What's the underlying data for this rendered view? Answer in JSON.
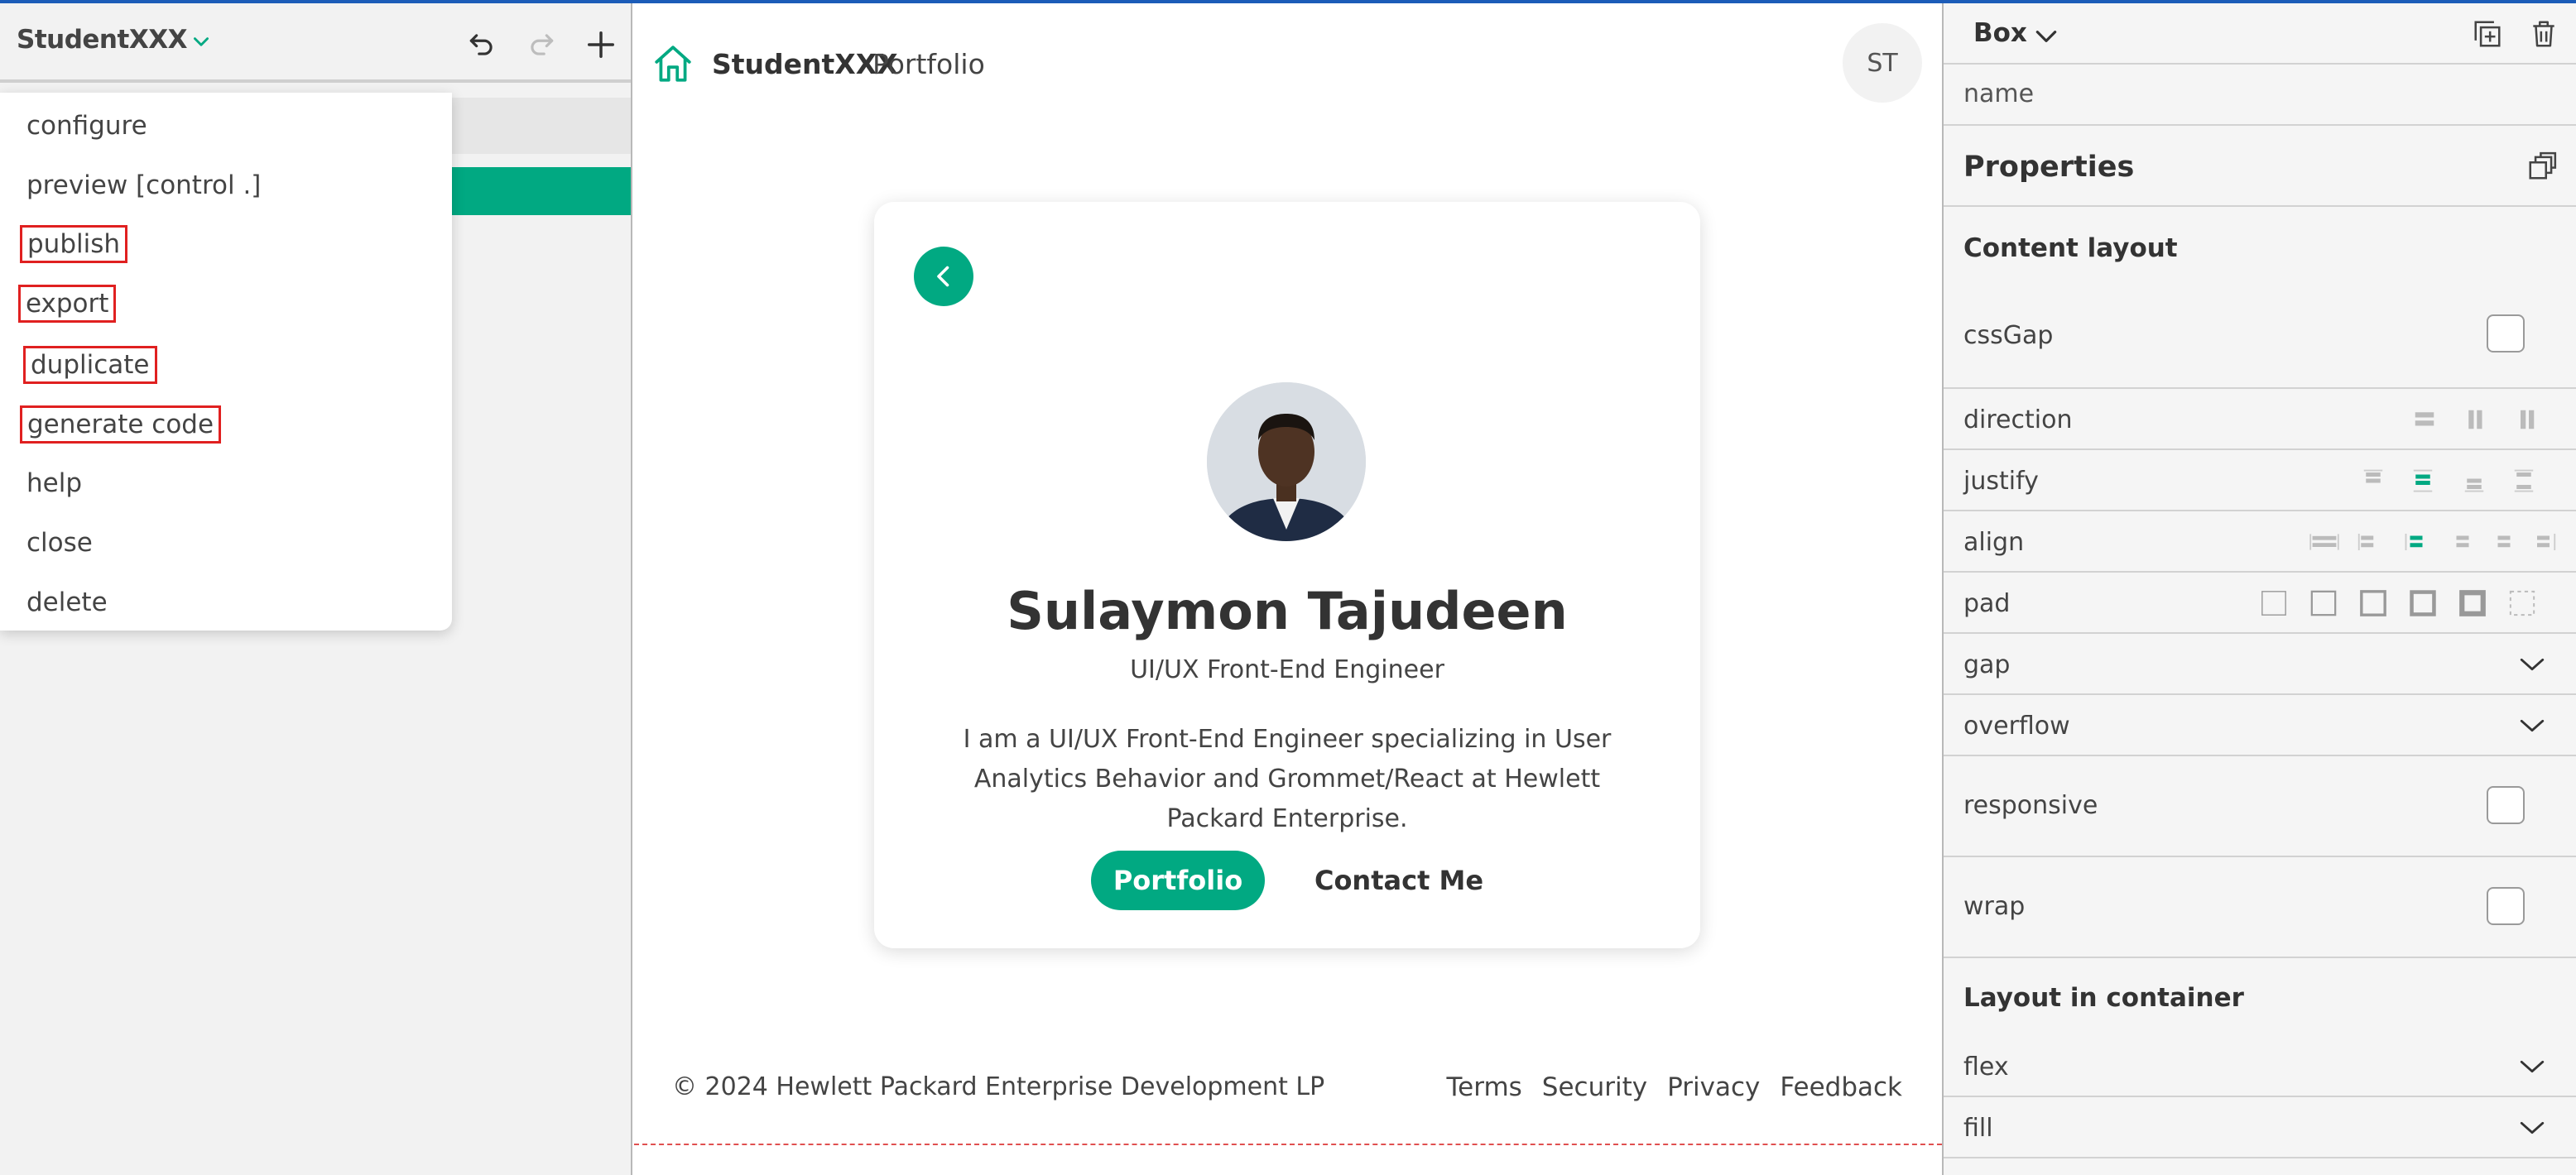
{
  "app": {
    "name": "StudentXXX",
    "icons": {
      "dropdown": "chevron-down-icon",
      "undo": "undo-icon",
      "redo": "redo-icon",
      "add": "plus-icon"
    }
  },
  "menu": {
    "items": [
      {
        "label": "configure",
        "highlighted": false
      },
      {
        "label": "preview [control .]",
        "highlighted": false
      },
      {
        "label": "publish",
        "highlighted": true
      },
      {
        "label": "export",
        "highlighted": true
      },
      {
        "label": "duplicate",
        "highlighted": true
      },
      {
        "label": "generate code",
        "highlighted": true
      },
      {
        "label": "help",
        "highlighted": false
      },
      {
        "label": "close",
        "highlighted": false
      },
      {
        "label": "delete",
        "highlighted": false
      }
    ]
  },
  "canvas": {
    "header": {
      "brand": "StudentXXX",
      "section": "Portfolio",
      "avatar_initials": "ST"
    },
    "card": {
      "name": "Sulaymon Tajudeen",
      "role": "UI/UX Front-End Engineer",
      "bio": "I am a UI/UX Front-End Engineer specializing in User Analytics Behavior and Grommet/React at Hewlett Packard Enterprise.",
      "primary_button": "Portfolio",
      "secondary_button": "Contact Me"
    },
    "footer": {
      "copyright": "© 2024 Hewlett Packard Enterprise Development LP",
      "links": [
        "Terms",
        "Security",
        "Privacy",
        "Feedback"
      ]
    }
  },
  "inspector": {
    "component": "Box",
    "name_placeholder": "name",
    "properties_title": "Properties",
    "content_layout_title": "Content layout",
    "rows": {
      "cssGap": "cssGap",
      "direction": "direction",
      "justify": "justify",
      "align": "align",
      "pad": "pad",
      "gap": "gap",
      "overflow": "overflow",
      "responsive": "responsive",
      "wrap": "wrap"
    },
    "layout_in_container_title": "Layout in container",
    "container_rows": {
      "flex": "flex",
      "fill": "fill"
    }
  },
  "colors": {
    "brand_green": "#01a982",
    "highlight_red": "#e02020",
    "top_accent": "#1c5cb8"
  }
}
